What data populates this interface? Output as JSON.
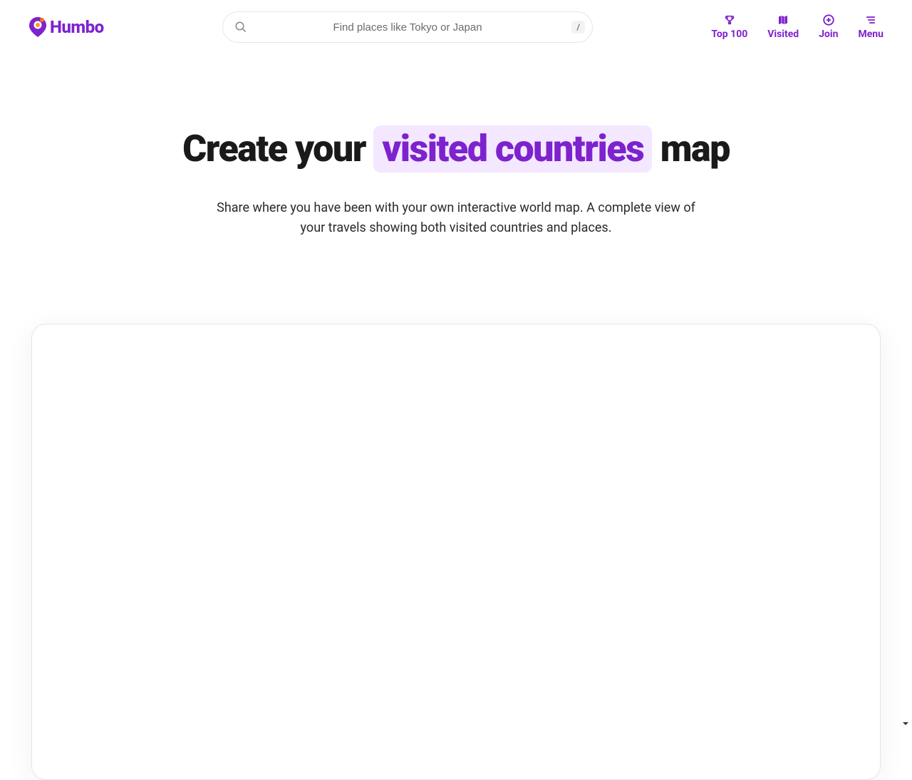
{
  "brand": {
    "name": "Humbo"
  },
  "search": {
    "placeholder": "Find places like Tokyo or Japan",
    "shortcut": "/"
  },
  "nav": {
    "top100": "Top 100",
    "visited": "Visited",
    "join": "Join",
    "menu": "Menu"
  },
  "hero": {
    "title_prefix": "Create your ",
    "title_highlight": "visited countries",
    "title_suffix": " map",
    "subtitle": "Share where you have been with your own interactive world map. A complete view of your travels showing both visited countries and places."
  },
  "colors": {
    "accent": "#7e22ce",
    "highlight_bg": "#f3e8ff"
  }
}
